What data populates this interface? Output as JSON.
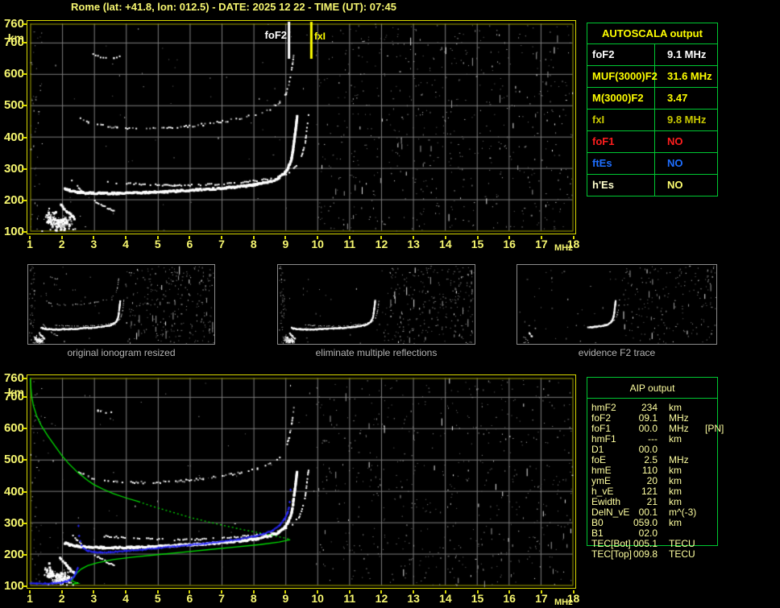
{
  "title": "Rome (lat: +41.8, lon: 012.5) - DATE: 2025 12 22 - TIME (UT): 07:45",
  "colors": {
    "accent_yellow": "#f6f670",
    "plot_border": "#d9d900",
    "inner_axis": "#a6a600",
    "grid": "#7d7d7d",
    "table_border": "#00c832",
    "green_curve": "#00dc00",
    "blue_trace": "#2828ff",
    "caption_gray": "#b4b4b4",
    "aip_text": "#ffffa0"
  },
  "autoscala": {
    "header": "AUTOSCALA output",
    "rows": [
      {
        "label": "foF2",
        "value": "9.1 MHz",
        "color": "#ffffff"
      },
      {
        "label": "MUF(3000)F2",
        "value": "31.6 MHz",
        "color": "#ffff00"
      },
      {
        "label": "M(3000)F2",
        "value": "3.47",
        "color": "#ffff00"
      },
      {
        "label": "fxI",
        "value": "9.8 MHz",
        "color": "#c9c900"
      },
      {
        "label": "foF1",
        "value": "NO",
        "color": "#ff1e1e"
      },
      {
        "label": "ftEs",
        "value": "NO",
        "color": "#1e6eff"
      },
      {
        "label": "h'Es",
        "value": "NO",
        "color": "#ffffcd",
        "value_color": "#ffff70"
      }
    ]
  },
  "aip": {
    "header": "AIP output",
    "rows": [
      {
        "label": "hmF2",
        "value": "234",
        "unit": "km",
        "extra": ""
      },
      {
        "label": "foF2",
        "value": "09.1",
        "unit": "MHz",
        "extra": ""
      },
      {
        "label": "foF1",
        "value": "00.0",
        "unit": "MHz",
        "extra": "[PN]"
      },
      {
        "label": "hmF1",
        "value": "---",
        "unit": "km",
        "extra": ""
      },
      {
        "label": "D1",
        "value": "00.0",
        "unit": "",
        "extra": ""
      },
      {
        "label": "foE",
        "value": "2.5",
        "unit": "MHz",
        "extra": ""
      },
      {
        "label": "hmE",
        "value": "110",
        "unit": "km",
        "extra": ""
      },
      {
        "label": "ymE",
        "value": "20",
        "unit": "km",
        "extra": ""
      },
      {
        "label": "h_vE",
        "value": "121",
        "unit": "km",
        "extra": ""
      },
      {
        "label": "Ewidth",
        "value": "21",
        "unit": "km",
        "extra": ""
      },
      {
        "label": "DelN_vE",
        "value": "00.1",
        "unit": "m^(-3)",
        "extra": ""
      },
      {
        "label": "B0",
        "value": "059.0",
        "unit": "km",
        "extra": ""
      },
      {
        "label": "B1",
        "value": "02.0",
        "unit": "",
        "extra": ""
      },
      {
        "label": "TEC[Bot]",
        "value": "005.1",
        "unit": "TECU",
        "extra": ""
      },
      {
        "label": "TEC[Top]",
        "value": "009.8",
        "unit": "TECU",
        "extra": ""
      }
    ]
  },
  "thumbnails": [
    {
      "caption": "original ionogram resized"
    },
    {
      "caption": "eliminate multiple reflections"
    },
    {
      "caption": "evidence F2 trace"
    }
  ],
  "axes": {
    "y_ticks": [
      760,
      700,
      600,
      500,
      400,
      300,
      200,
      100
    ],
    "y_unit": "km",
    "x_ticks": [
      1,
      2,
      3,
      4,
      5,
      6,
      7,
      8,
      9,
      10,
      11,
      12,
      13,
      14,
      15,
      16,
      17,
      18
    ],
    "x_unit": "MHz"
  },
  "chart_data": [
    {
      "id": "scaled_ionogram",
      "type": "scatter",
      "title": "autoscaled ionogram with foF2 and fxI markers",
      "xlabel": "MHz",
      "ylabel": "km",
      "xlim": [
        1,
        18
      ],
      "ylim": [
        100,
        760
      ],
      "grid": true,
      "markers": [
        {
          "name": "foF2",
          "x": 9.1,
          "color": "#ffffff"
        },
        {
          "name": "fxI",
          "x": 9.8,
          "color": "#ffff00"
        }
      ],
      "noise_start_mhz": 9.95,
      "traces": {
        "f_trace": [
          [
            2.05,
            238
          ],
          [
            2.2,
            232
          ],
          [
            2.45,
            227
          ],
          [
            2.8,
            224
          ],
          [
            3.2,
            223
          ],
          [
            3.7,
            223
          ],
          [
            4.2,
            224
          ],
          [
            4.7,
            226
          ],
          [
            5.2,
            228
          ],
          [
            5.7,
            231
          ],
          [
            6.2,
            234
          ],
          [
            6.7,
            237
          ],
          [
            7.2,
            241
          ],
          [
            7.7,
            246
          ],
          [
            8.1,
            252
          ],
          [
            8.5,
            261
          ],
          [
            8.75,
            272
          ],
          [
            8.95,
            288
          ],
          [
            9.05,
            305
          ],
          [
            9.15,
            330
          ],
          [
            9.2,
            360
          ],
          [
            9.25,
            400
          ],
          [
            9.3,
            440
          ],
          [
            9.33,
            468
          ]
        ],
        "fx_trace": [
          [
            3.3,
            258
          ],
          [
            4.0,
            253
          ],
          [
            4.8,
            249
          ],
          [
            5.5,
            247
          ],
          [
            6.2,
            248
          ],
          [
            7.0,
            252
          ],
          [
            7.7,
            258
          ],
          [
            8.3,
            265
          ],
          [
            8.7,
            273
          ],
          [
            9.0,
            283
          ],
          [
            9.2,
            297
          ],
          [
            9.4,
            318
          ],
          [
            9.5,
            345
          ],
          [
            9.6,
            385
          ],
          [
            9.65,
            430
          ],
          [
            9.7,
            470
          ]
        ],
        "second_hop": [
          [
            2.5,
            462
          ],
          [
            2.8,
            448
          ],
          [
            3.2,
            438
          ],
          [
            3.7,
            432
          ],
          [
            4.3,
            429
          ],
          [
            5.0,
            430
          ],
          [
            5.7,
            434
          ],
          [
            6.4,
            441
          ],
          [
            7.0,
            450
          ],
          [
            7.6,
            461
          ],
          [
            8.1,
            474
          ],
          [
            8.5,
            490
          ],
          [
            8.8,
            512
          ],
          [
            9.0,
            540
          ],
          [
            9.1,
            575
          ],
          [
            9.18,
            620
          ],
          [
            9.24,
            665
          ]
        ],
        "high_arc": [
          [
            2.95,
            668
          ],
          [
            3.1,
            659
          ],
          [
            3.35,
            652
          ],
          [
            3.6,
            652
          ],
          [
            3.78,
            657
          ]
        ],
        "streak_a": [
          [
            1.9,
            188
          ],
          [
            2.35,
            143
          ]
        ],
        "streak_b": [
          [
            3.0,
            197
          ],
          [
            3.6,
            164
          ]
        ],
        "streak_c": [
          [
            2.28,
            262
          ],
          [
            2.71,
            219
          ]
        ],
        "streak_d": [
          [
            1.45,
            158
          ],
          [
            1.85,
            122
          ]
        ],
        "e_base": [
          [
            1.35,
            104
          ],
          [
            2.45,
            107
          ]
        ]
      },
      "e_blob": {
        "center": [
          1.95,
          126
        ],
        "sigma": [
          0.2,
          14
        ],
        "count": 130
      }
    },
    {
      "id": "aip_ionogram_with_profile",
      "type": "scatter",
      "title": "ionogram with electron density profile (green) and restored trace (blue)",
      "xlabel": "MHz",
      "ylabel": "km",
      "xlim": [
        1,
        18
      ],
      "ylim": [
        100,
        760
      ],
      "grid": true,
      "noise_start_mhz": 9.95,
      "profile_green": [
        [
          1.0,
          760
        ],
        [
          1.02,
          730
        ],
        [
          1.05,
          700
        ],
        [
          1.1,
          672
        ],
        [
          1.2,
          640
        ],
        [
          1.35,
          608
        ],
        [
          1.55,
          576
        ],
        [
          1.8,
          540
        ],
        [
          2.0,
          512
        ],
        [
          2.2,
          488
        ],
        [
          2.5,
          458
        ],
        [
          2.8,
          434
        ],
        [
          3.0,
          420
        ],
        [
          3.3,
          405
        ],
        [
          3.6,
          392
        ],
        [
          4.0,
          378
        ],
        [
          4.4,
          366
        ],
        [
          4.8,
          352
        ],
        [
          5.2,
          340
        ],
        [
          5.6,
          328
        ],
        [
          6.0,
          316
        ],
        [
          6.4,
          306
        ],
        [
          6.8,
          296
        ],
        [
          7.2,
          287
        ],
        [
          7.6,
          278
        ],
        [
          8.0,
          270
        ],
        [
          8.4,
          262
        ],
        [
          8.8,
          254
        ],
        [
          9.05,
          248
        ],
        [
          9.15,
          245
        ],
        [
          8.8,
          237
        ],
        [
          8.2,
          229
        ],
        [
          7.4,
          221
        ],
        [
          6.6,
          213
        ],
        [
          5.8,
          205
        ],
        [
          5.0,
          197
        ],
        [
          4.2,
          189
        ],
        [
          3.6,
          181
        ],
        [
          3.1,
          171
        ],
        [
          2.8,
          162
        ],
        [
          2.6,
          151
        ],
        [
          2.45,
          137
        ],
        [
          2.35,
          124
        ],
        [
          2.3,
          114
        ],
        [
          2.4,
          109
        ],
        [
          2.5,
          106
        ],
        [
          2.3,
          103
        ]
      ],
      "profile_dash_range": [
        4.4,
        9.0
      ],
      "restored_trace_blue": [
        [
          1.0,
          107
        ],
        [
          1.2,
          106
        ],
        [
          1.45,
          106
        ],
        [
          1.7,
          107
        ],
        [
          1.95,
          109
        ],
        [
          2.1,
          112
        ],
        [
          2.25,
          118
        ],
        [
          2.35,
          127
        ],
        [
          2.42,
          140
        ],
        [
          2.48,
          156
        ]
      ],
      "restored_trace_blue2": [
        [
          2.65,
          218
        ],
        [
          2.8,
          210
        ],
        [
          3.0,
          206
        ],
        [
          3.2,
          205
        ],
        [
          3.5,
          206
        ],
        [
          4.0,
          210
        ],
        [
          4.5,
          214
        ],
        [
          5.0,
          219
        ],
        [
          5.5,
          224
        ],
        [
          6.0,
          229
        ],
        [
          6.5,
          234
        ],
        [
          7.0,
          240
        ],
        [
          7.5,
          247
        ],
        [
          8.0,
          256
        ],
        [
          8.3,
          264
        ],
        [
          8.6,
          276
        ],
        [
          8.8,
          290
        ],
        [
          8.95,
          310
        ],
        [
          9.05,
          330
        ],
        [
          9.1,
          348
        ]
      ],
      "blue_isolated": [
        [
          2.5,
          290
        ],
        [
          2.52,
          258
        ],
        [
          2.56,
          241
        ],
        [
          2.6,
          228
        ],
        [
          9.12,
          366
        ],
        [
          9.15,
          405
        ]
      ]
    }
  ]
}
